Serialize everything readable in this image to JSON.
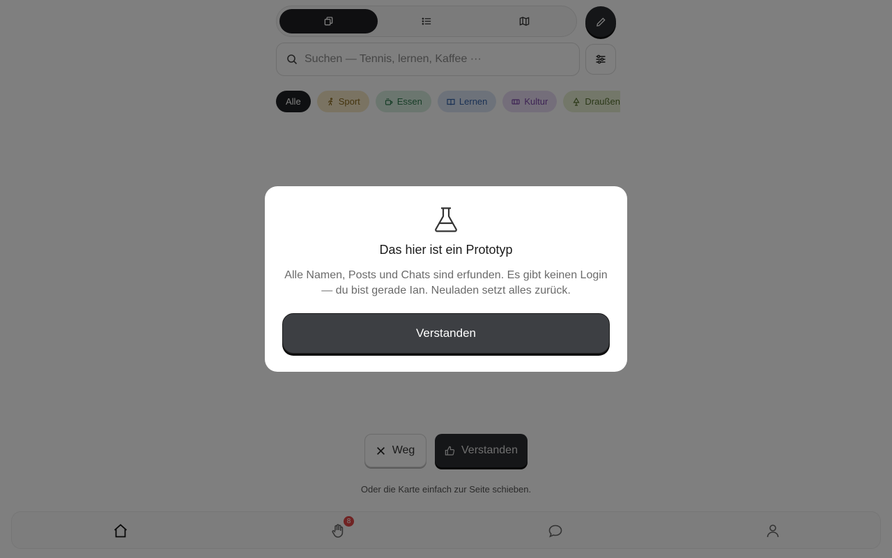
{
  "search": {
    "placeholder": "Suchen — Tennis, lernen, Kaffee ···"
  },
  "view_toggle": {
    "items": [
      {
        "icon": "cards-icon",
        "active": true
      },
      {
        "icon": "list-icon",
        "active": false
      },
      {
        "icon": "map-icon",
        "active": false
      }
    ]
  },
  "categories": [
    {
      "label": "Alle",
      "active": true
    },
    {
      "label": "Sport",
      "icon": "running-icon",
      "bg": "#f4e6c4",
      "color": "#8a6a1e"
    },
    {
      "label": "Essen",
      "icon": "coffee-icon",
      "bg": "#d6ecdf",
      "color": "#2f7a4f"
    },
    {
      "label": "Lernen",
      "icon": "book-icon",
      "bg": "#dbe5f5",
      "color": "#3563a8"
    },
    {
      "label": "Kultur",
      "icon": "ticket-icon",
      "bg": "#e9ddf4",
      "color": "#7a46a8"
    },
    {
      "label": "Draußen",
      "icon": "tree-icon",
      "bg": "#e6efd3",
      "color": "#567030"
    }
  ],
  "actions": {
    "dismiss_label": "Weg",
    "accept_label": "Verstanden",
    "hint": "Oder die Karte einfach zur Seite schieben."
  },
  "bottom_nav": {
    "items": [
      {
        "icon": "home-icon"
      },
      {
        "icon": "hand-icon",
        "badge": "8"
      },
      {
        "icon": "chat-icon"
      },
      {
        "icon": "user-icon"
      }
    ]
  },
  "modal": {
    "icon": "flask-icon",
    "title": "Das hier ist ein Prototyp",
    "body": "Alle Namen, Posts und Chats sind erfunden. Es gibt keinen Login — du bist gerade Ian. Neuladen setzt alles zurück.",
    "button": "Verstanden"
  },
  "colors": {
    "dark": "#1f2124",
    "modal_button": "#3d3f43",
    "badge": "#e04646",
    "overlay": "rgba(0,0,0,0.5)"
  }
}
